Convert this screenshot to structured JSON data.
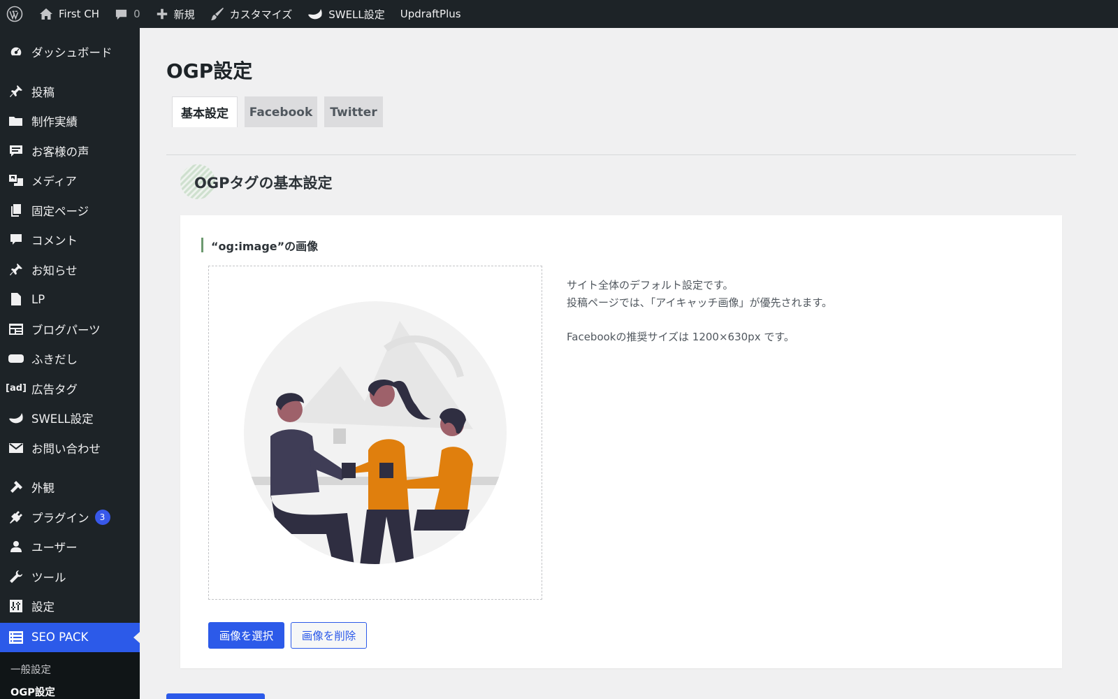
{
  "adminbar": {
    "items": [
      {
        "id": "wp",
        "icon": "wordpress-logo-icon",
        "label": ""
      },
      {
        "id": "site",
        "icon": "home-icon",
        "label": "First CH"
      },
      {
        "id": "comments",
        "icon": "comment-bubble-icon",
        "label": "",
        "count": "0"
      },
      {
        "id": "new",
        "icon": "plus-icon",
        "label": "新規"
      },
      {
        "id": "customize",
        "icon": "paintbrush-icon",
        "label": "カスタマイズ"
      },
      {
        "id": "swell",
        "icon": "swell-wave-icon",
        "label": "SWELL設定"
      },
      {
        "id": "updraft",
        "icon": "",
        "label": "UpdraftPlus"
      }
    ]
  },
  "sidebar": {
    "items": [
      {
        "label": "ダッシュボード",
        "icon": "dashboard-gauge-icon"
      },
      {
        "label": "投稿",
        "icon": "pin-icon"
      },
      {
        "label": "制作実績",
        "icon": "folder-icon"
      },
      {
        "label": "お客様の声",
        "icon": "speech-bubble-icon"
      },
      {
        "label": "メディア",
        "icon": "media-icon"
      },
      {
        "label": "固定ページ",
        "icon": "pages-icon"
      },
      {
        "label": "コメント",
        "icon": "comment-icon"
      },
      {
        "label": "お知らせ",
        "icon": "pin-icon"
      },
      {
        "label": "LP",
        "icon": "document-icon"
      },
      {
        "label": "ブログパーツ",
        "icon": "layout-grid-icon"
      },
      {
        "label": "ふきだし",
        "icon": "bubble-rect-icon"
      },
      {
        "label": "広告タグ",
        "icon": "ad-icon",
        "icon_text": "[ad]"
      },
      {
        "label": "SWELL設定",
        "icon": "swell-wave-icon"
      },
      {
        "label": "お問い合わせ",
        "icon": "envelope-icon"
      },
      {
        "label": "外観",
        "icon": "appearance-brush-icon"
      },
      {
        "label": "プラグイン",
        "icon": "plugin-icon",
        "badge": "3"
      },
      {
        "label": "ユーザー",
        "icon": "user-icon"
      },
      {
        "label": "ツール",
        "icon": "wrench-icon"
      },
      {
        "label": "設定",
        "icon": "settings-sliders-icon"
      },
      {
        "label": "SEO PACK",
        "icon": "list-icon"
      }
    ],
    "submenu": [
      "一般設定",
      "OGP設定"
    ]
  },
  "page": {
    "title": "OGP設定",
    "tabs": [
      "基本設定",
      "Facebook",
      "Twitter"
    ],
    "section_title": "OGPタグの基本設定",
    "field_label": "“og:image”の画像",
    "description": {
      "line1": "サイト全体のデフォルト設定です。",
      "line2": "投稿ページでは、「アイキャッチ画像」が優先されます。",
      "line3": "Facebookの推奨サイズは 1200×630px です。"
    },
    "buttons": {
      "select": "画像を選択",
      "delete": "画像を削除"
    }
  },
  "colors": {
    "adminbar_bg": "#1d2327",
    "accent": "#2c5ae9",
    "page_bg": "#f0f0f1",
    "badge": "#3858e9",
    "illustration_orange": "#e07f0d",
    "illustration_dark": "#3f3d56"
  }
}
